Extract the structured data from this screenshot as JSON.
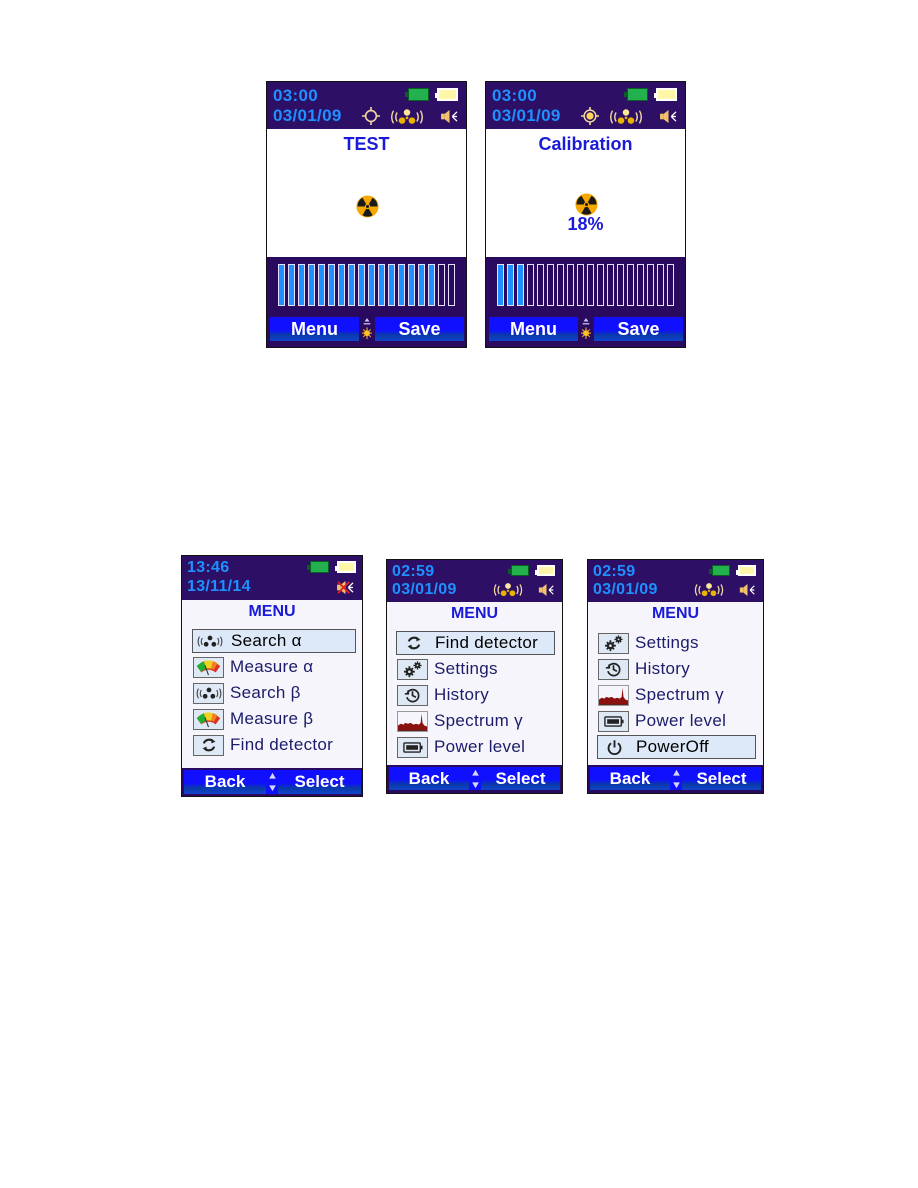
{
  "screens": {
    "test": {
      "time": "03:00",
      "date": "03/01/09",
      "status_icons": [
        "battery-green-icon",
        "battery-yellow-icon",
        "crosshair-icon",
        "radiation-signal-icon",
        "speaker-icon"
      ],
      "title": "TEST",
      "center_icon": "radiation-icon",
      "bar_total": 18,
      "bar_filled": 16,
      "footer": {
        "left": "Menu",
        "right": "Save",
        "middle_icon": "sun-updown-icon"
      }
    },
    "calibration": {
      "time": "03:00",
      "date": "03/01/09",
      "status_icons": [
        "battery-green-icon",
        "battery-yellow-icon",
        "sun-target-icon",
        "radiation-signal-icon",
        "speaker-icon"
      ],
      "title": "Calibration",
      "center_icon": "radiation-icon",
      "percent": "18%",
      "bar_total": 18,
      "bar_filled": 3,
      "footer": {
        "left": "Menu",
        "right": "Save",
        "middle_icon": "sun-updown-icon"
      }
    },
    "menu1": {
      "time": "13:46",
      "date": "13/11/14",
      "status_icons": [
        "battery-green-icon",
        "battery-yellow-icon",
        "speaker-muted-icon"
      ],
      "title": "MENU",
      "items": [
        {
          "label": "Search α",
          "icon": "radiation-signal-icon",
          "selected": true
        },
        {
          "label": "Measure α",
          "icon": "gauge-icon",
          "selected": false
        },
        {
          "label": "Search β",
          "icon": "radiation-signal-icon",
          "selected": false
        },
        {
          "label": "Measure β",
          "icon": "gauge-icon",
          "selected": false
        },
        {
          "label": "Find detector",
          "icon": "refresh-icon",
          "selected": false
        }
      ],
      "footer": {
        "left": "Back",
        "right": "Select",
        "middle_icon": "updown-arrows-icon"
      }
    },
    "menu2": {
      "time": "02:59",
      "date": "03/01/09",
      "status_icons": [
        "battery-green-icon",
        "battery-yellow-icon",
        "radiation-signal-icon",
        "speaker-icon"
      ],
      "title": "MENU",
      "items": [
        {
          "label": "Find detector",
          "icon": "refresh-icon",
          "selected": true
        },
        {
          "label": "Settings",
          "icon": "gears-icon",
          "selected": false
        },
        {
          "label": "History",
          "icon": "history-icon",
          "selected": false
        },
        {
          "label": "Spectrum γ",
          "icon": "spectrum-icon",
          "selected": false
        },
        {
          "label": "Power level",
          "icon": "battery-icon",
          "selected": false
        }
      ],
      "footer": {
        "left": "Back",
        "right": "Select",
        "middle_icon": "updown-arrows-icon"
      }
    },
    "menu3": {
      "time": "02:59",
      "date": "03/01/09",
      "status_icons": [
        "battery-green-icon",
        "battery-yellow-icon",
        "radiation-signal-icon",
        "speaker-icon"
      ],
      "title": "MENU",
      "items": [
        {
          "label": "Settings",
          "icon": "gears-icon",
          "selected": false
        },
        {
          "label": "History",
          "icon": "history-icon",
          "selected": false
        },
        {
          "label": "Spectrum γ",
          "icon": "spectrum-icon",
          "selected": false
        },
        {
          "label": "Power level",
          "icon": "battery-icon",
          "selected": false
        },
        {
          "label": "PowerOff",
          "icon": "power-icon",
          "selected": true
        }
      ],
      "footer": {
        "left": "Back",
        "right": "Select",
        "middle_icon": "updown-arrows-icon"
      }
    }
  },
  "colors": {
    "header_bg": "#2d0f66",
    "time_blue": "#1e90ff",
    "title_blue": "#1a1ad8",
    "bar_fill": "#1e90ff",
    "footer_button": "#1010ff",
    "radiation_yellow": "#f5a800"
  }
}
